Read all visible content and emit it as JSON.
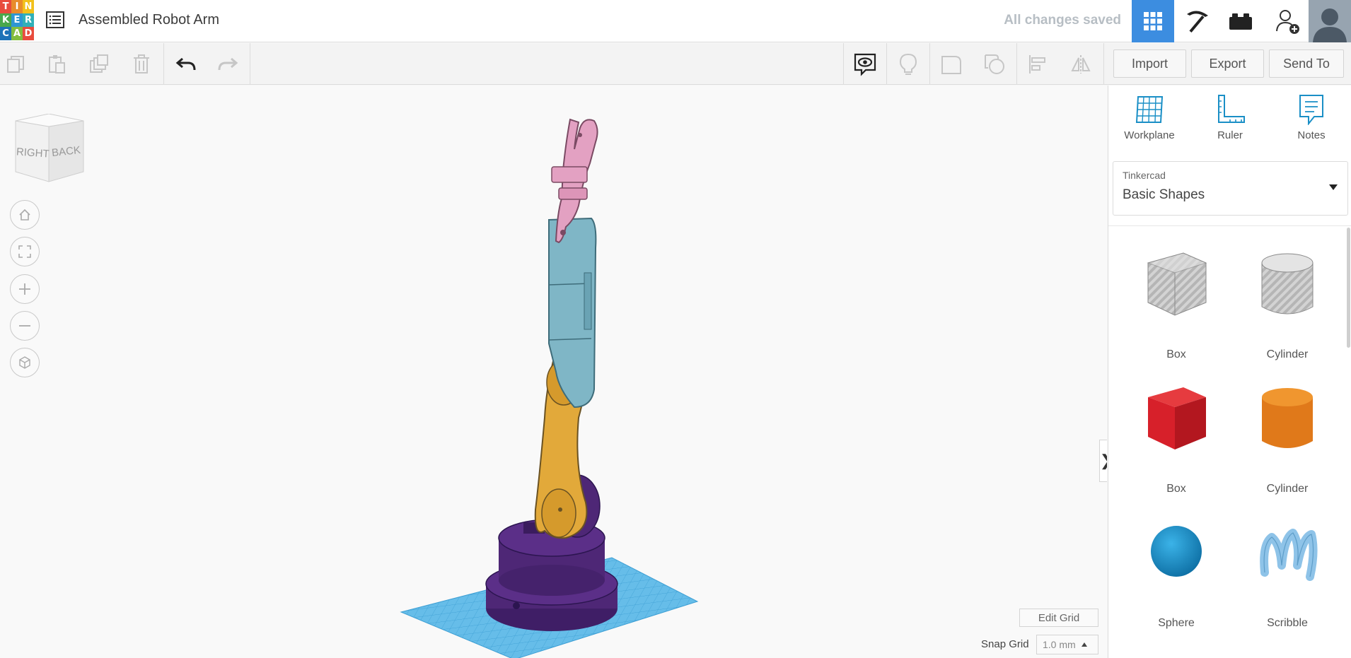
{
  "app": {
    "logo_letters": [
      "T",
      "I",
      "N",
      "K",
      "E",
      "R",
      "C",
      "A",
      "D"
    ],
    "logo_colors": [
      "#e84c3d",
      "#e88c2b",
      "#f2c11b",
      "#48a74b",
      "#2e96d3",
      "#31b0b8",
      "#1e72b8",
      "#83bd3f",
      "#e84c3d"
    ],
    "document_title": "Assembled Robot Arm",
    "save_status": "All changes saved"
  },
  "header_icons": [
    "grid-view-icon",
    "pickaxe-icon",
    "brick-icon",
    "add-user-icon",
    "avatar"
  ],
  "toolbar": {
    "import_label": "Import",
    "export_label": "Export",
    "send_to_label": "Send To"
  },
  "viewcube": {
    "face_right": "RIGHT",
    "face_back": "BACK"
  },
  "canvas": {
    "edit_grid_label": "Edit Grid",
    "snap_grid_label": "Snap Grid",
    "snap_grid_value": "1.0 mm"
  },
  "panel": {
    "tools": [
      {
        "label": "Workplane",
        "icon": "workplane-icon"
      },
      {
        "label": "Ruler",
        "icon": "ruler-icon"
      },
      {
        "label": "Notes",
        "icon": "notes-icon"
      }
    ],
    "library": {
      "source": "Tinkercad",
      "name": "Basic Shapes"
    },
    "shapes": [
      {
        "label": "Box",
        "style": "hole"
      },
      {
        "label": "Cylinder",
        "style": "hole"
      },
      {
        "label": "Box",
        "color": "#d7202a"
      },
      {
        "label": "Cylinder",
        "color": "#e8861d"
      },
      {
        "label": "Sphere",
        "color": "#1c95cf"
      },
      {
        "label": "Scribble",
        "color": "#8ec3e8"
      }
    ]
  },
  "colors": {
    "accent": "#3c8de0",
    "arm_pink": "#e3a1c2",
    "arm_blue": "#7fb6c6",
    "arm_gold": "#e2a93a",
    "base_purple": "#4e2776",
    "grid_blue": "#5fb7e6"
  }
}
